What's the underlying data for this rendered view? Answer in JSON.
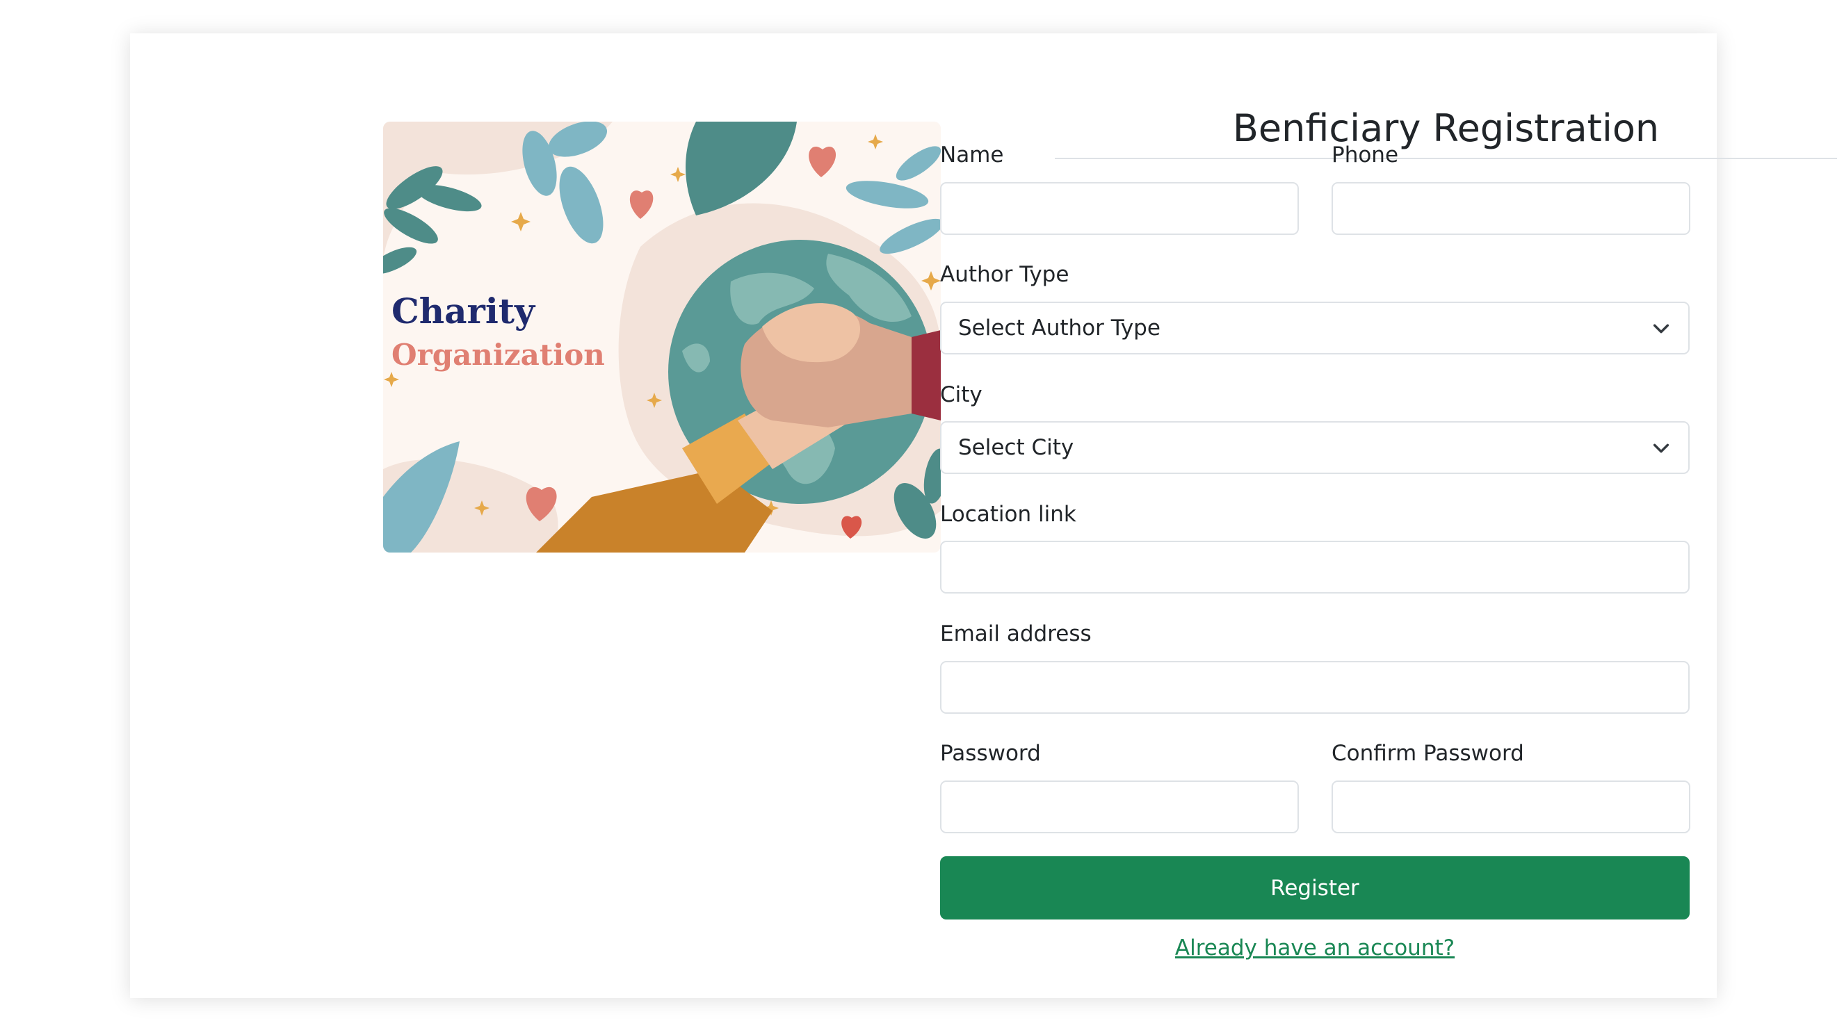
{
  "hero": {
    "title_line1": "Charity",
    "title_line2": "Organization",
    "colors": {
      "title1": "#1f2a6e",
      "title2": "#e07f72",
      "globe": "#5a9a96",
      "sleeve": "#c9822a"
    }
  },
  "form": {
    "title": "Benficiary Registration",
    "fields": {
      "name": {
        "label": "Name",
        "value": ""
      },
      "phone": {
        "label": "Phone",
        "value": ""
      },
      "author_type": {
        "label": "Author Type",
        "selected": "Select Author Type"
      },
      "city": {
        "label": "City",
        "selected": "Select City"
      },
      "location": {
        "label": "Location link",
        "value": ""
      },
      "email": {
        "label": "Email address",
        "value": ""
      },
      "password": {
        "label": "Password",
        "value": ""
      },
      "confirm_password": {
        "label": "Confirm Password",
        "value": ""
      }
    },
    "submit_label": "Register",
    "login_link": "Already have an account?",
    "colors": {
      "primary": "#198754",
      "border": "#dee2e6",
      "text": "#212529"
    },
    "icons": {
      "dropdown": "chevron-down-icon"
    }
  }
}
